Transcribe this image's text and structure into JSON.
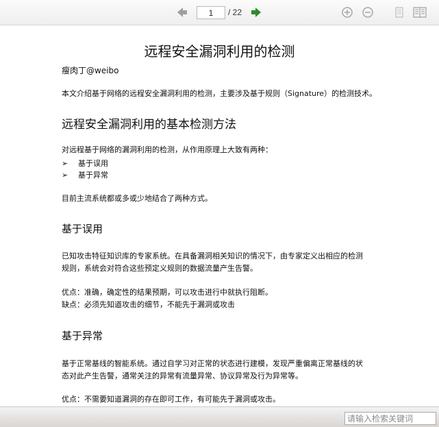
{
  "toolbar": {
    "page_current": "1",
    "page_total": "/ 22",
    "icons": {
      "prev": "arrow-left-icon",
      "next": "arrow-right-icon",
      "zoom_in": "zoom-in-icon",
      "zoom_out": "zoom-out-icon",
      "single_page": "single-page-view-icon",
      "double_page": "double-page-view-icon"
    },
    "colors": {
      "next_arrow": "#2f8a2f",
      "prev_arrow": "#9aa09a",
      "icon_gray": "#a8a8a8"
    }
  },
  "document": {
    "title": "远程安全漏洞利用的检测",
    "author": "瘦肉丁@weibo",
    "intro": "本文介绍基于网络的远程安全漏洞利用的检测，主要涉及基于规则（Signature）的检测技术。",
    "section1": {
      "heading": "远程安全漏洞利用的基本检测方法",
      "lead": "对远程基于网络的漏洞利用的检测，从作用原理上大致有两种：",
      "bullets": [
        "基于误用",
        "基于异常"
      ],
      "bullet_marker": "➢",
      "summary": "目前主流系统都或多或少地结合了两种方式。"
    },
    "section2": {
      "heading": "基于误用",
      "para1_line1": "已知攻击特征知识库的专家系统。在具备漏洞相关知识的情况下，由专家定义出相应的检测",
      "para1_line2": "规则，系统会对符合这些预定义规则的数据流量产生告警。",
      "pros": "优点：准确，确定性的结果预期，可以攻击进行中就执行阻断。",
      "cons": "缺点：必须先知道攻击的细节，不能先于漏洞或攻击"
    },
    "section3": {
      "heading": "基于异常",
      "para1_line1": "基于正常基线的智能系统。通过自学习对正常的状态进行建模，发现严重偏离正常基线的状",
      "para1_line2": "态对此产生告警，通常关注的异常有流量异常、协议异常及行为异常等。",
      "pros": "优点：不需要知道漏洞的存在即可工作，有可能先于漏洞或攻击。"
    }
  },
  "bottom": {
    "search_placeholder": "请输入检索关键词"
  }
}
